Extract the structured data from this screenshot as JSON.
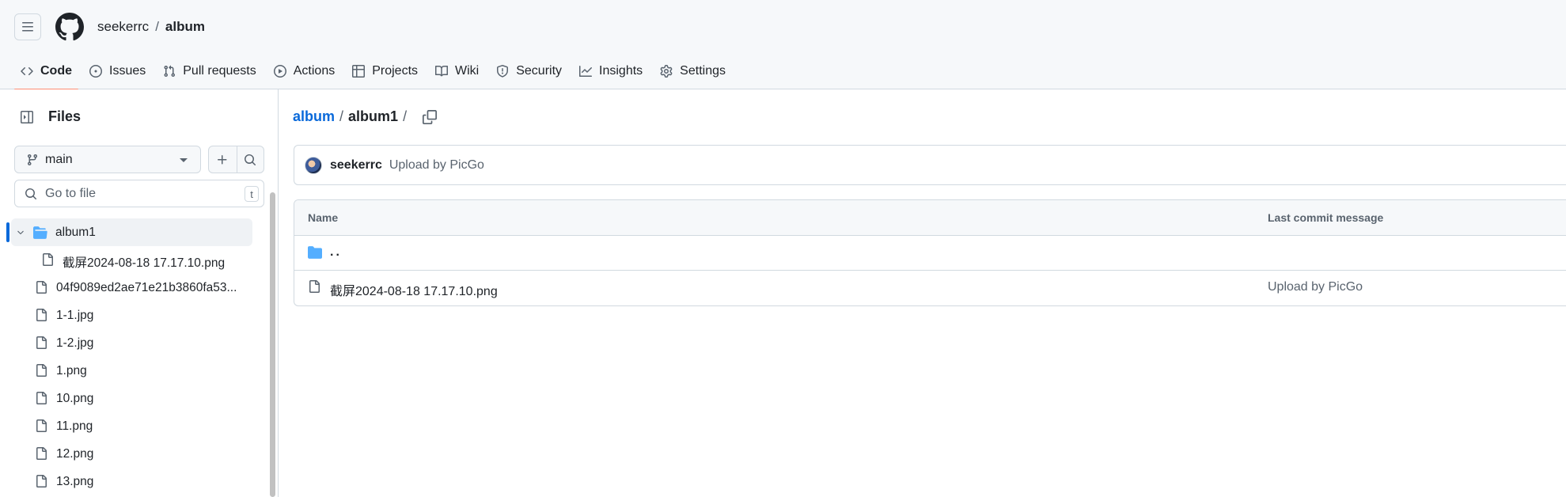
{
  "header": {
    "owner": "seekerrc",
    "separator": "/",
    "repo": "album"
  },
  "tabs": [
    {
      "label": "Code",
      "icon": "code-icon",
      "active": true
    },
    {
      "label": "Issues",
      "icon": "issue-opened-icon"
    },
    {
      "label": "Pull requests",
      "icon": "git-pull-request-icon"
    },
    {
      "label": "Actions",
      "icon": "play-icon"
    },
    {
      "label": "Projects",
      "icon": "table-icon"
    },
    {
      "label": "Wiki",
      "icon": "book-icon"
    },
    {
      "label": "Security",
      "icon": "shield-icon"
    },
    {
      "label": "Insights",
      "icon": "graph-icon"
    },
    {
      "label": "Settings",
      "icon": "gear-icon"
    }
  ],
  "sidebar": {
    "title": "Files",
    "branch": "main",
    "goto_placeholder": "Go to file",
    "goto_shortcut": "t",
    "tree": [
      {
        "name": "album1",
        "type": "folder",
        "expanded": true,
        "selected": true
      },
      {
        "name": "截屏2024-08-18 17.17.10.png",
        "type": "file",
        "nested": true
      },
      {
        "name": "04f9089ed2ae71e21b3860fa53...",
        "type": "file"
      },
      {
        "name": "1-1.jpg",
        "type": "file"
      },
      {
        "name": "1-2.jpg",
        "type": "file"
      },
      {
        "name": "1.png",
        "type": "file"
      },
      {
        "name": "10.png",
        "type": "file"
      },
      {
        "name": "11.png",
        "type": "file"
      },
      {
        "name": "12.png",
        "type": "file"
      },
      {
        "name": "13.png",
        "type": "file"
      }
    ]
  },
  "main": {
    "path_root": "album",
    "path_sep": "/",
    "path_current": "album1",
    "path_trailing": "/",
    "commit": {
      "author": "seekerrc",
      "message": "Upload by PicGo"
    },
    "table": {
      "col_name": "Name",
      "col_commit": "Last commit message",
      "rows": [
        {
          "name": "..",
          "type": "parent",
          "commit": ""
        },
        {
          "name": "截屏2024-08-18 17.17.10.png",
          "type": "file",
          "commit": "Upload by PicGo"
        }
      ]
    }
  },
  "colors": {
    "accent": "#0969da",
    "active_tab_underline": "#fd8c73",
    "folder": "#54aeff"
  }
}
